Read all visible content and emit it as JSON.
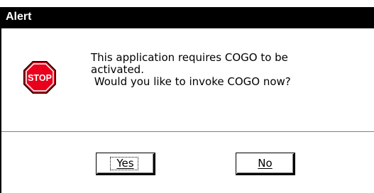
{
  "window": {
    "title": "Alert"
  },
  "icon": {
    "name": "stop-icon",
    "text": "STOP",
    "color": "#e8001c"
  },
  "message": {
    "lines": [
      "This application requires COGO to be",
      "activated.",
      " Would you like to invoke COGO now?"
    ]
  },
  "buttons": {
    "yes_label": "Yes",
    "no_label": "No"
  }
}
